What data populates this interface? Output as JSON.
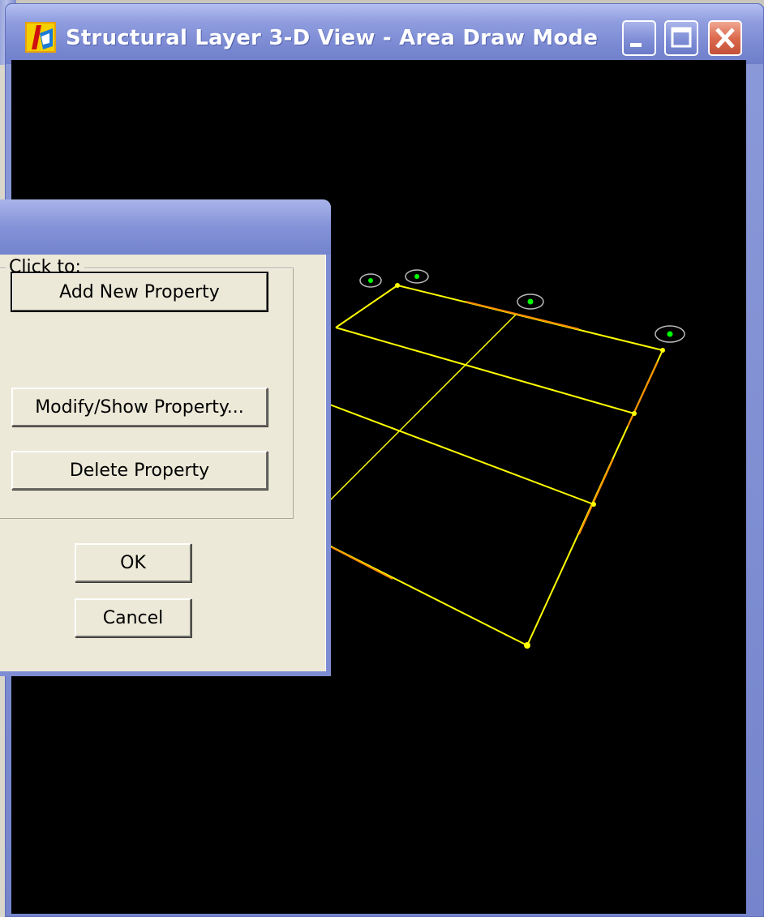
{
  "window": {
    "title": "Structural Layer  3-D View - Area Draw Mode",
    "icons": {
      "app": "structural-app-icon",
      "minimize": "minimize-icon",
      "maximize": "maximize-icon",
      "close": "close-icon"
    }
  },
  "dialog": {
    "group_label": "Click to:",
    "buttons": {
      "add_new": "Add New Property",
      "modify_show": "Modify/Show Property...",
      "delete": "Delete Property",
      "ok": "OK",
      "cancel": "Cancel"
    }
  },
  "colors": {
    "title_bar": "#7a89d2",
    "viewport_bg": "#000000",
    "grid_line": "#ffff00",
    "highlight_line": "#ff8c00",
    "support_marker": "#00ff00",
    "dialog_face": "#ece9d8",
    "close_button": "#db6a4e"
  }
}
